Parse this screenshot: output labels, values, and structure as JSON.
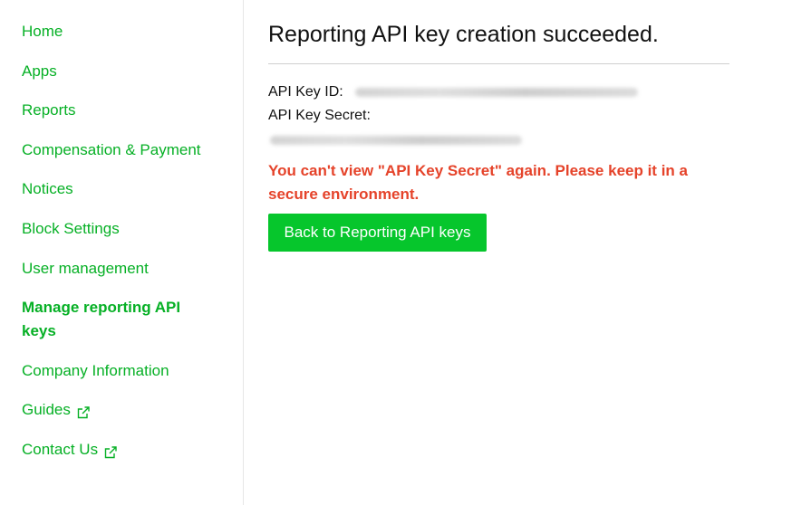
{
  "sidebar": {
    "items": [
      {
        "label": "Home",
        "external": false,
        "active": false
      },
      {
        "label": "Apps",
        "external": false,
        "active": false
      },
      {
        "label": "Reports",
        "external": false,
        "active": false
      },
      {
        "label": "Compensation & Payment",
        "external": false,
        "active": false
      },
      {
        "label": "Notices",
        "external": false,
        "active": false
      },
      {
        "label": "Block Settings",
        "external": false,
        "active": false
      },
      {
        "label": "User management",
        "external": false,
        "active": false
      },
      {
        "label": "Manage reporting API keys",
        "external": false,
        "active": true
      },
      {
        "label": "Company Information",
        "external": false,
        "active": false
      },
      {
        "label": "Guides",
        "external": true,
        "active": false
      },
      {
        "label": "Contact Us",
        "external": true,
        "active": false
      }
    ]
  },
  "main": {
    "title": "Reporting API key creation succeeded.",
    "api_key_id_label": "API Key ID:",
    "api_key_secret_label": "API Key Secret:",
    "warning": "You can't view \"API Key Secret\" again. Please keep it in a secure environment.",
    "back_button": "Back to Reporting API keys"
  },
  "colors": {
    "accent": "#06b025",
    "button": "#06c62c",
    "warning": "#e5432a"
  },
  "icons": {
    "external": "external-link-icon"
  }
}
